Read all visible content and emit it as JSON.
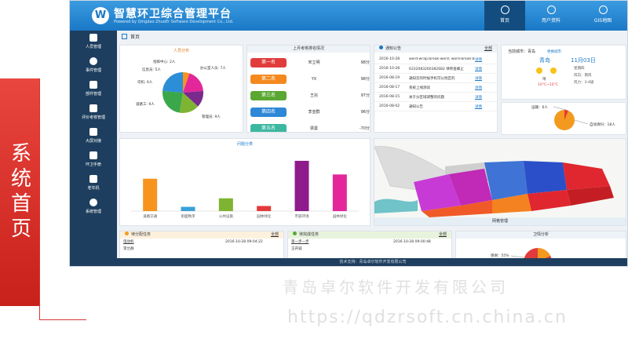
{
  "slide": {
    "side_title": "系统首页",
    "watermark_company": "青岛卓尔软件开发有限公司",
    "watermark_url": "https://qdzrsoft.cn.china.cn"
  },
  "app": {
    "title": "智慧环卫综合管理平台",
    "subtitle": "Powered by Qingdao ZhuoEr Software Development Co., Ltd.",
    "top_nav": [
      "首页",
      "用户资料",
      "GIS地图"
    ],
    "sidebar": [
      "人员管理",
      "事件管理",
      "部件管理",
      "评价考核管理",
      "大屏对接",
      "环卫手册",
      "老年机",
      "系统管理"
    ],
    "breadcrumb": "首页",
    "footer": "技术支持：青岛卓尔软件开发有限公司"
  },
  "personnel": {
    "title": "人员分布",
    "legend": [
      {
        "label": "指挥中心: 2人",
        "value": 2,
        "color": "#f7941d"
      },
      {
        "label": "办公室人员: 7人",
        "value": 7,
        "color": "#e3279b"
      },
      {
        "label": "信息员: 5人",
        "value": 5,
        "color": "#7a2a8c"
      },
      {
        "label": "司机: 6人",
        "value": 6,
        "color": "#7fb433"
      },
      {
        "label": "道路工: 9人",
        "value": 9,
        "color": "#3aa84a"
      },
      {
        "label": "管理员: 9人",
        "value": 9,
        "color": "#2d8ed8"
      }
    ]
  },
  "ranking": {
    "title": "上月考核排名情况",
    "rows": [
      {
        "rank": "第一名",
        "name": "宋立明",
        "score": "98分",
        "color": "#e23b3b"
      },
      {
        "rank": "第二名",
        "name": "YX",
        "score": "98分",
        "color": "#f48a1f"
      },
      {
        "rank": "第三名",
        "name": "王兆",
        "score": "97分",
        "color": "#5aa832"
      },
      {
        "rank": "第四名",
        "name": "李亚群",
        "score": "96分",
        "color": "#2e87d7"
      },
      {
        "rank": "第五名",
        "name": "梁曼",
        "score": "-70分",
        "color": "#3cb7a0"
      }
    ]
  },
  "notices": {
    "title": "通知公告",
    "more": "全部",
    "rows": [
      {
        "date": "2016-10-28",
        "title": "word-wrap:break-word; word-break:br",
        "link": "详情"
      },
      {
        "date": "2016-10-28",
        "title": "6332083260382682 律师查峰止",
        "link": "详情"
      },
      {
        "date": "2016-08-19",
        "title": "通知云的时候手机可以找区的",
        "link": "详情"
      },
      {
        "date": "2016-08-17",
        "title": "系统上线测试",
        "link": "详情"
      },
      {
        "date": "2016-08-15",
        "title": "关于分区域调整的问题",
        "link": "详情"
      },
      {
        "date": "2016-08-02",
        "title": "通知公告",
        "link": "详情"
      }
    ]
  },
  "weather": {
    "current_city": "当前城市：青岛",
    "switch_city": "更换城市",
    "city": "青岛",
    "date": "11月03日",
    "weekday": "星期四",
    "condition": "晴",
    "temp": "10°C~10°C",
    "wind": "风向：南风",
    "wind_level": "风力：3-4级"
  },
  "vehicle_pie": {
    "labels": [
      "运输：6人",
      "自动清扫：18人"
    ]
  },
  "events": {
    "title": "问题分类",
    "chart_data": {
      "type": "bar",
      "categories": [
        "道路交通",
        "街面秩序",
        "公共设施",
        "园林绿化",
        "市容环境",
        "园林绿化"
      ],
      "values": [
        3.8,
        0.5,
        1.5,
        0.6,
        5.9,
        4.3
      ],
      "colors": [
        "#f7941d",
        "#3aa0d8",
        "#7fb433",
        "#e23b3b",
        "#8e1a8c",
        "#e3279b"
      ],
      "ylim": [
        0,
        7
      ]
    }
  },
  "map": {
    "caption": "网格管理"
  },
  "pending": {
    "title": "待分配任务",
    "more": "全部",
    "row_name": "电动机",
    "row_date": "2016-10-28 09:04:22",
    "row_person": "李兰群"
  },
  "processed": {
    "title": "待完成任务",
    "more": "全部",
    "row_name": "第一步一步",
    "row_date": "2016-10-28 09:00:48",
    "row_person": "王开诚"
  },
  "sanitation": {
    "title": "卫情分析",
    "label": "感谢：55%"
  }
}
